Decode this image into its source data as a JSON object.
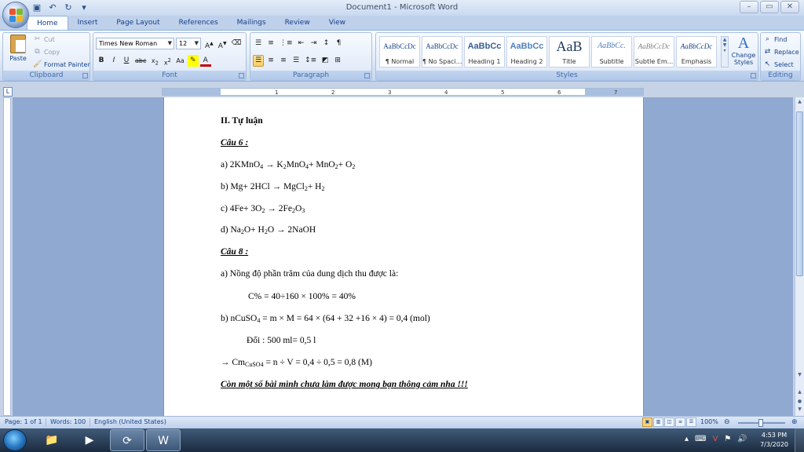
{
  "window": {
    "title": "Document1 - Microsoft Word",
    "controls": [
      "–",
      "▭",
      "✕"
    ]
  },
  "tabs": [
    "Home",
    "Insert",
    "Page Layout",
    "References",
    "Mailings",
    "Review",
    "View"
  ],
  "ribbon": {
    "clipboard": {
      "label": "Clipboard",
      "paste": "Paste",
      "cut": "Cut",
      "copy": "Copy",
      "format_painter": "Format Painter"
    },
    "font": {
      "label": "Font",
      "family": "Times New Roman",
      "size": "12"
    },
    "paragraph": {
      "label": "Paragraph"
    },
    "styles": {
      "label": "Styles",
      "items": [
        {
          "sample": "AaBbCcDc",
          "name": "¶ Normal"
        },
        {
          "sample": "AaBbCcDc",
          "name": "¶ No Spaci..."
        },
        {
          "sample": "AaBbCc",
          "name": "Heading 1"
        },
        {
          "sample": "AaBbCc",
          "name": "Heading 2"
        },
        {
          "sample": "AaB",
          "name": "Title"
        },
        {
          "sample": "AaBbCc.",
          "name": "Subtitle"
        },
        {
          "sample": "AaBbCcDc",
          "name": "Subtle Em..."
        },
        {
          "sample": "AaBbCcDc",
          "name": "Emphasis"
        }
      ],
      "change_styles": "Change Styles"
    },
    "editing": {
      "label": "Editing",
      "find": "Find",
      "replace": "Replace",
      "select": "Select"
    }
  },
  "document": {
    "l1": "II. Tự luận",
    "l2": "Câu 6 :",
    "l3a": "a) 2KMnO",
    "l3b": "4",
    "l3c": " → K",
    "l3d": "2",
    "l3e": "MnO",
    "l3f": "4",
    "l3g": "+ MnO",
    "l3h": "2",
    "l3i": "+ O",
    "l3j": "2",
    "l4a": "b) Mg+ 2HCl → MgCl",
    "l4b": "2",
    "l4c": "+ H",
    "l4d": "2",
    "l5a": "c) 4Fe+ 3O",
    "l5b": "2",
    "l5c": " → 2Fe",
    "l5d": "2",
    "l5e": "O",
    "l5f": "3",
    "l6a": "d) Na",
    "l6b": "2",
    "l6c": "O+ H",
    "l6d": "2",
    "l6e": "O → 2NaOH",
    "l7": "Câu 8 :",
    "l8": "a) Nồng độ phần trăm của dung dịch thu được là:",
    "l9": "C% = 40÷160 × 100% = 40%",
    "l10a": "b) nCuSO",
    "l10b": "4",
    "l10c": " = m × M = 64 × (64 + 32 +16 × 4) = 0,4 (mol)",
    "l11": "Đổi : 500 ml= 0,5 l",
    "l12a": "→ Cm",
    "l12b": "CuSO4",
    "l12c": " = n ÷ V = 0,4 ÷ 0,5 = 0,8 (M)",
    "l13": "Còn một số bài mình chưa làm được mong bạn thông cảm nha !!!"
  },
  "status": {
    "page": "Page: 1 of 1",
    "words": "Words: 100",
    "language": "English (United States)",
    "zoom": "100%"
  },
  "taskbar": {
    "time": "4:53 PM",
    "date": "7/3/2020"
  }
}
